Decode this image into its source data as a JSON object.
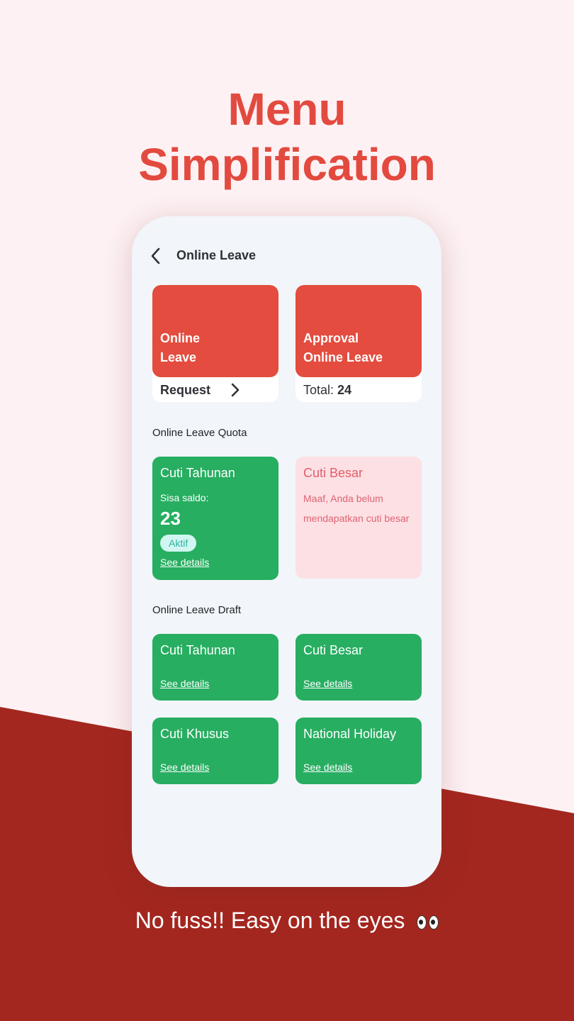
{
  "headline": {
    "line1": "Menu",
    "line2": "Simplification"
  },
  "tagline": "No fuss!! Easy on the eyes",
  "screen": {
    "back_icon": "chevron-left-icon",
    "title": "Online Leave",
    "menu": [
      {
        "label_line1": "Online",
        "label_line2": "Leave",
        "footer": "Request",
        "footer_icon": "chevron-right-icon"
      },
      {
        "label_line1": "Approval",
        "label_line2": "Online Leave",
        "footer_prefix": "Total:",
        "footer_value": "24"
      }
    ],
    "quota_section": {
      "title": "Online Leave Quota",
      "annual": {
        "title": "Cuti Tahunan",
        "balance_label": "Sisa saldo:",
        "balance": "23",
        "status": "Aktif",
        "link": "See details"
      },
      "long": {
        "title": "Cuti Besar",
        "message": "Maaf, Anda belum mendapatkan cuti besar"
      }
    },
    "draft_section": {
      "title": "Online Leave Draft",
      "items": [
        {
          "title": "Cuti Tahunan",
          "link": "See details"
        },
        {
          "title": "Cuti Besar",
          "link": "See details"
        },
        {
          "title": "Cuti Khusus",
          "link": "See details"
        },
        {
          "title": "National Holiday",
          "link": "See details"
        }
      ]
    }
  },
  "colors": {
    "accent_red": "#e34c3e",
    "dark_red": "#a3271f",
    "green": "#27ae61",
    "pink_card": "#fde0e4",
    "badge_bg": "#d1f6f1"
  }
}
